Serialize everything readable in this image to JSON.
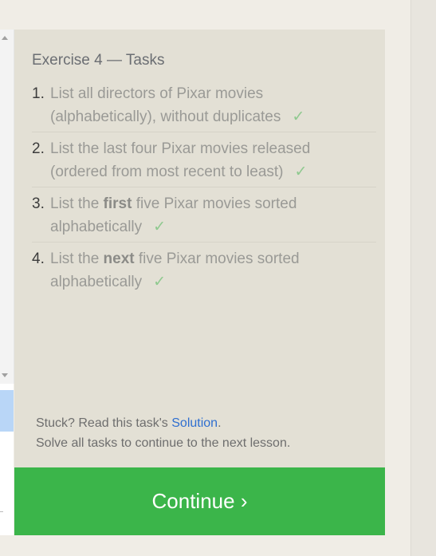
{
  "panel": {
    "title": "Exercise 4 — Tasks",
    "tasks": [
      {
        "number": "1.",
        "line1": "List all directors of Pixar movies",
        "line2": "(alphabetically), without duplicates",
        "check": "✓"
      },
      {
        "number": "2.",
        "line1": "List the last four Pixar movies released",
        "line2": "(ordered from most recent to least)",
        "check": "✓"
      },
      {
        "number": "3.",
        "prefix": "List the ",
        "bold": "first",
        "suffix": " five Pixar movies sorted",
        "line2": "alphabetically",
        "check": "✓"
      },
      {
        "number": "4.",
        "prefix": "List the ",
        "bold": "next",
        "suffix": " five Pixar movies sorted",
        "line2": "alphabetically",
        "check": "✓"
      }
    ],
    "stuck_text": "Stuck? Read this task's ",
    "solution_link": "Solution",
    "stuck_suffix": ".",
    "solve_all_text": "Solve all tasks to continue to the next lesson."
  },
  "continue_button": {
    "label": "Continue ›"
  },
  "colors": {
    "panel_bg": "#e3e0d5",
    "continue_bg": "#3bb54a",
    "check": "#8fc98f",
    "link": "#2f6fd0"
  }
}
